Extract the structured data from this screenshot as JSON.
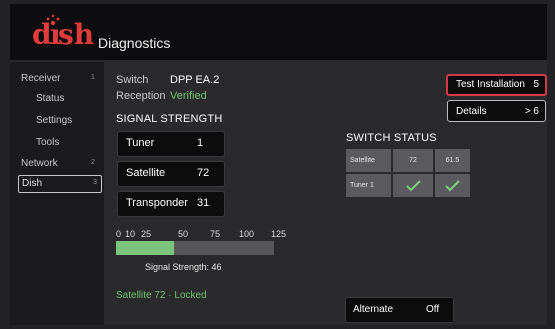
{
  "header": {
    "brand": "dish",
    "title": "Diagnostics"
  },
  "sidebar": {
    "items": [
      {
        "label": "Receiver",
        "number": "1"
      },
      {
        "label": "Status"
      },
      {
        "label": "Settings"
      },
      {
        "label": "Tools"
      },
      {
        "label": "Network",
        "number": "2"
      },
      {
        "label": "Dish",
        "number": "3"
      }
    ]
  },
  "info": {
    "switch_label": "Switch",
    "switch_value": "DPP EA.2",
    "reception_label": "Reception",
    "reception_value": "Verified"
  },
  "signal": {
    "title": "SIGNAL STRENGTH",
    "tuner_label": "Tuner",
    "tuner_value": "1",
    "satellite_label": "Satellite",
    "satellite_value": "72",
    "transponder_label": "Transponder",
    "transponder_value": "31",
    "scale_ticks": [
      "0",
      "10",
      "25",
      "50",
      "75",
      "100",
      "125"
    ],
    "strength_label": "Signal Strength: 46",
    "strength_value": 46,
    "scale_max": 125
  },
  "status_line": {
    "satellite": "Satellite 72",
    "separator": "·",
    "state": "Locked"
  },
  "buttons": {
    "test_installation_label": "Test Installation",
    "test_installation_value": "5",
    "details_label": "Details",
    "details_value": "> 6"
  },
  "switch_status": {
    "title": "SWITCH STATUS",
    "row1": [
      "Satellite",
      "72",
      "61.5"
    ],
    "row2_label": "Tuner 1",
    "row2_icons": [
      "check-icon",
      "check-icon"
    ]
  },
  "alternate": {
    "label": "Alternate",
    "value": "Off"
  },
  "colors": {
    "accent_red": "#d23a46",
    "success_green": "#6ec46e",
    "bar_green": "#7bc47b"
  }
}
